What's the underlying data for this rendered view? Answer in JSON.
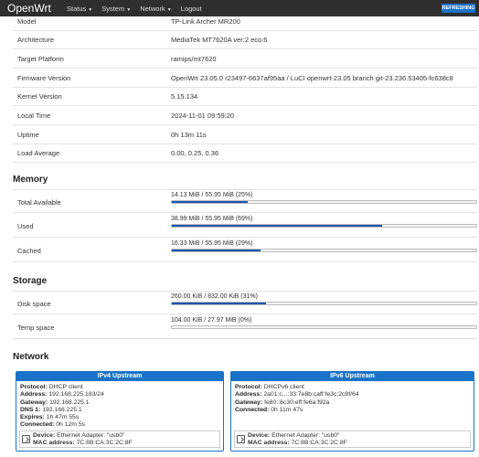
{
  "nav": {
    "brand": "OpenWrt",
    "menu": [
      {
        "label": "Status"
      },
      {
        "label": "System"
      },
      {
        "label": "Network"
      },
      {
        "label": "Logout"
      }
    ],
    "refresh_label": "REFRESHING",
    "accent": "#1a73c9"
  },
  "system": [
    {
      "key": "Model",
      "value": "TP-Link Archer MR200"
    },
    {
      "key": "Architecture",
      "value": "MediaTek MT7620A ver:2 eco:6"
    },
    {
      "key": "Target Platform",
      "value": "ramips/mt7620"
    },
    {
      "key": "Firmware Version",
      "value": "OpenWrt 23.05.0 r23497-6637af95aa / LuCI openwrt-23.05 branch git-23.236.53405-fc638c8"
    },
    {
      "key": "Kernel Version",
      "value": "5.15.134"
    },
    {
      "key": "Local Time",
      "value": "2024-11-01 09:59:20"
    },
    {
      "key": "Uptime",
      "value": "0h 13m 11s"
    },
    {
      "key": "Load Average",
      "value": "0.00, 0.25, 0.36"
    }
  ],
  "memory": {
    "title": "Memory",
    "rows": [
      {
        "key": "Total Available",
        "value": "14.13 MiB / 55.95 MiB (25%)",
        "percent": 25
      },
      {
        "key": "Used",
        "value": "38.99 MiB / 55.95 MiB (69%)",
        "percent": 69
      },
      {
        "key": "Cached",
        "value": "16.33 MiB / 55.95 MiB (29%)",
        "percent": 29
      }
    ]
  },
  "storage": {
    "title": "Storage",
    "rows": [
      {
        "key": "Disk space",
        "value": "260.00 KiB / 832.00 KiB (31%)",
        "percent": 31
      },
      {
        "key": "Temp space",
        "value": "104.00 KiB / 27.97 MiB (0%)",
        "percent": 0
      }
    ]
  },
  "network": {
    "title": "Network",
    "ipv4": {
      "header": "IPv4 Upstream",
      "lines": [
        {
          "label": "Protocol:",
          "value": "DHCP client"
        },
        {
          "label": "Address:",
          "value": "192.168.225.183/24"
        },
        {
          "label": "Gateway:",
          "value": "192.168.225.1"
        },
        {
          "label": "DNS 1:",
          "value": "192.168.225.1"
        },
        {
          "label": "Expires:",
          "value": "1h 47m 55s"
        },
        {
          "label": "Connected:",
          "value": "0h 12m 5s"
        }
      ],
      "device_label": "Device:",
      "device_value": "Ethernet Adapter: \"usb0\"",
      "mac_label": "MAC address:",
      "mac_value": "7C:8B:CA:3C:2C:8F"
    },
    "ipv6": {
      "header": "IPv6 Upstream",
      "lines": [
        {
          "label": "Protocol:",
          "value": "DHCPv6 client"
        },
        {
          "label": "Address:",
          "value": "2a01:c...:33:7e8b:caff:fe3c:2c8f/64"
        },
        {
          "label": "Gateway:",
          "value": "fe80::6c30:eff:fe6a:f92a"
        },
        {
          "label": "Connected:",
          "value": "0h 11m 47s"
        }
      ],
      "device_label": "Device:",
      "device_value": "Ethernet Adapter: \"usb0\"",
      "mac_label": "MAC address:",
      "mac_value": "7C:8B:CA:3C:2C:8F"
    }
  }
}
